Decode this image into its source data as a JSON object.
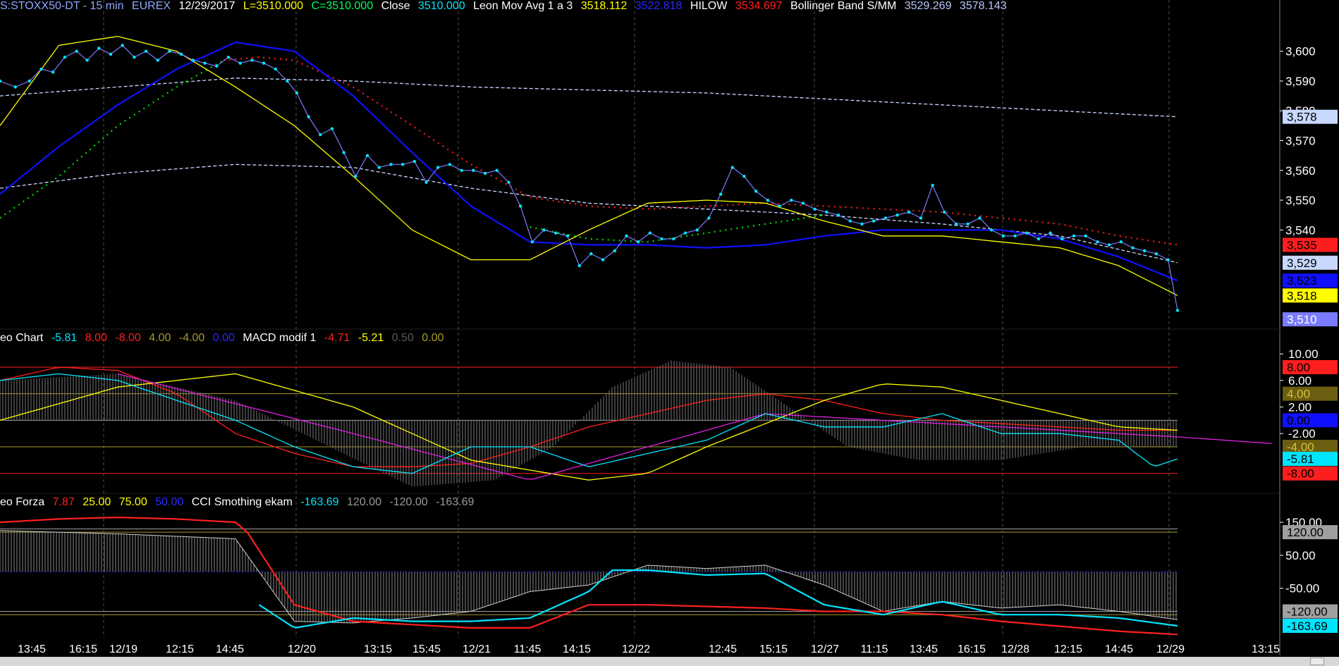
{
  "header": {
    "symbol": "S:STOXX50-DT - 15 min",
    "exchange": "EUREX",
    "date": "12/29/2017",
    "low": "L=3510.000",
    "close_eq": "C=3510.000",
    "close_label": "Close",
    "close_value": "3510.000",
    "leon_label": "Leon Mov Avg 1 a 3",
    "leon_v1": "3518.112",
    "leon_v2": "3522.818",
    "hilow_label": "HILOW",
    "hilow_value": "3534.697",
    "boll_label": "Bollinger Band S/MM",
    "boll_v1": "3529.269",
    "boll_v2": "3578.143"
  },
  "panel1_header": {
    "name": "eo Chart",
    "v1": "-5.81",
    "v2": "8.00",
    "v3": "-8.00",
    "v4": "4.00",
    "v5": "-4.00",
    "v6": "0.00",
    "macd_label": "MACD modif 1",
    "m1": "-4.71",
    "m2": "-5.21",
    "m3": "0.50",
    "m4": "0.00"
  },
  "panel2_header": {
    "name": "eo Forza",
    "v1": "7.87",
    "v2": "25.00",
    "v3": "75.00",
    "v4": "50.00",
    "cci_label": "CCI Smothing ekam",
    "c1": "-163.69",
    "c2": "120.00",
    "c3": "-120.00",
    "c4": "-163.69"
  },
  "colors": {
    "price": "#00e5ff",
    "price_line": "#7b7bff",
    "leon_fast": "#ffff00",
    "leon_slow": "#1010ff",
    "hilow": "#ff1e1e",
    "boll": "#c8d8ff",
    "green": "#00e000",
    "magenta": "#e020e0",
    "grid": "#404040"
  },
  "chart_data": [
    {
      "type": "line",
      "title": "S:STOXX50-DT - 15 min",
      "xlabel": "",
      "ylabel": "",
      "ylim": [
        3506,
        3612
      ],
      "yticks": [
        "3,600",
        "3,590",
        "3,580",
        "3,570",
        "3,560",
        "3,550",
        "3,540"
      ],
      "ytick_values": [
        3600,
        3590,
        3580,
        3570,
        3560,
        3550,
        3540
      ],
      "x_labels": [
        "13:45",
        "16:15",
        "12/19",
        "12:15",
        "14:45",
        "12/20",
        "13:15",
        "15:45",
        "12/21",
        "11:45",
        "14:15",
        "12/22",
        "12:45",
        "15:15",
        "12/27",
        "11:15",
        "13:45",
        "16:15",
        "12/28",
        "12:15",
        "14:45",
        "12/29",
        "13:15"
      ],
      "series": [
        {
          "name": "Close",
          "color": "#00e5ff",
          "t": [
            0,
            0.013,
            0.025,
            0.035,
            0.045,
            0.055,
            0.065,
            0.074,
            0.084,
            0.094,
            0.104,
            0.114,
            0.124,
            0.134,
            0.144,
            0.154,
            0.164,
            0.174,
            0.184,
            0.194,
            0.204,
            0.214,
            0.224,
            0.234,
            0.244,
            0.252,
            0.262,
            0.272,
            0.282,
            0.292,
            0.302,
            0.312,
            0.322,
            0.332,
            0.342,
            0.352,
            0.362,
            0.372,
            0.382,
            0.392,
            0.402,
            0.412,
            0.422,
            0.432,
            0.442,
            0.452,
            0.462,
            0.472,
            0.482,
            0.492,
            0.502,
            0.512,
            0.522,
            0.532,
            0.542,
            0.552,
            0.562,
            0.572,
            0.582,
            0.592,
            0.602,
            0.612,
            0.622,
            0.632,
            0.642,
            0.652,
            0.662,
            0.672,
            0.682,
            0.692,
            0.702,
            0.712,
            0.722,
            0.732,
            0.742,
            0.752,
            0.762,
            0.772,
            0.782,
            0.792,
            0.802,
            0.812,
            0.822,
            0.832,
            0.842,
            0.852,
            0.862,
            0.872,
            0.882,
            0.892,
            0.902,
            0.912,
            0.922,
            0.932,
            0.942,
            0.952,
            0.962,
            0.972,
            0.982,
            0.992,
            1.0
          ],
          "values": [
            3590,
            3588,
            3590,
            3594,
            3593,
            3598,
            3600,
            3597,
            3601,
            3599,
            3602,
            3598,
            3600,
            3597,
            3600,
            3599,
            3597,
            3596,
            3595,
            3598,
            3596,
            3597,
            3596,
            3594,
            3590,
            3586,
            3578,
            3572,
            3574,
            3566,
            3558,
            3565,
            3561,
            3562,
            3562,
            3563,
            3556,
            3561,
            3562,
            3560,
            3560,
            3559,
            3560,
            3556,
            3548,
            3536,
            3540,
            3539,
            3538,
            3528,
            3532,
            3530,
            3533,
            3538,
            3536,
            3539,
            3537,
            3537,
            3539,
            3540,
            3544,
            3552,
            3561,
            3558,
            3553,
            3550,
            3548,
            3550,
            3549,
            3547,
            3546,
            3545,
            3543,
            3542,
            3543,
            3544,
            3545,
            3546,
            3544,
            3555,
            3546,
            3542,
            3542,
            3544,
            3540,
            3538,
            3538,
            3539,
            3537,
            3539,
            3537,
            3538,
            3538,
            3536,
            3535,
            3536,
            3534,
            3533,
            3532,
            3530,
            3513,
            3510
          ]
        },
        {
          "name": "Leon Mov Avg 1 a 3",
          "color": "#ffff00",
          "t": [
            0,
            0.05,
            0.1,
            0.15,
            0.2,
            0.25,
            0.3,
            0.35,
            0.4,
            0.45,
            0.5,
            0.55,
            0.6,
            0.65,
            0.7,
            0.75,
            0.8,
            0.85,
            0.9,
            0.95,
            1.0
          ],
          "values": [
            3575,
            3602,
            3605,
            3600,
            3588,
            3575,
            3558,
            3540,
            3530,
            3530,
            3540,
            3549,
            3550,
            3549,
            3543,
            3538,
            3538,
            3536,
            3534,
            3528,
            3518
          ]
        },
        {
          "name": "3522.818",
          "color": "#1010ff",
          "t": [
            0,
            0.05,
            0.1,
            0.15,
            0.2,
            0.25,
            0.3,
            0.35,
            0.4,
            0.45,
            0.5,
            0.55,
            0.6,
            0.65,
            0.7,
            0.75,
            0.8,
            0.85,
            0.9,
            0.95,
            1.0
          ],
          "values": [
            3552,
            3568,
            3582,
            3594,
            3603,
            3600,
            3585,
            3566,
            3548,
            3536,
            3535,
            3535,
            3534,
            3535,
            3538,
            3540,
            3540,
            3540,
            3537,
            3531,
            3523
          ]
        },
        {
          "name": "HILOW",
          "color": "#ff1e1e",
          "t": [
            0.19,
            0.22,
            0.25,
            0.3,
            0.35,
            0.4,
            0.45,
            0.5,
            0.55,
            0.6,
            0.65,
            0.7,
            0.75,
            0.8,
            0.85,
            0.9,
            0.95,
            1.0
          ],
          "values": [
            3597,
            3598,
            3597,
            3588,
            3575,
            3562,
            3551,
            3548,
            3547,
            3548,
            3549,
            3548,
            3547,
            3546,
            3544,
            3542,
            3538,
            3535
          ]
        },
        {
          "name": "Bollinger Band S/MM",
          "color": "#c8d8ff",
          "t": [
            0,
            0.1,
            0.2,
            0.3,
            0.4,
            0.5,
            0.6,
            0.7,
            0.8,
            0.9,
            1.0
          ],
          "values": [
            3585,
            3588,
            3591,
            3590,
            3588,
            3587,
            3586,
            3584,
            3582,
            3580,
            3578
          ]
        }
      ]
    },
    {
      "type": "line",
      "title": "MACD modif 1",
      "ylim": [
        -11,
        11.5
      ],
      "yticks": [
        "10.00",
        "6.00",
        "2.00",
        "-2.00"
      ],
      "ytick_values": [
        10,
        6,
        2,
        -2
      ],
      "levels": [
        8,
        -8,
        4,
        -4,
        0
      ],
      "badges": [
        "8.00",
        "4.00",
        "0.00",
        "-4.00",
        "-5.81",
        "-8.00"
      ],
      "badge_values": [
        8,
        4,
        0,
        -4,
        -5.81,
        -8
      ],
      "series": [
        {
          "name": "-5.81",
          "color": "#00e5ff",
          "t": [
            0,
            0.05,
            0.1,
            0.15,
            0.2,
            0.25,
            0.3,
            0.35,
            0.4,
            0.45,
            0.5,
            0.55,
            0.6,
            0.65,
            0.7,
            0.75,
            0.8,
            0.85,
            0.9,
            0.95,
            0.98,
            1.0
          ],
          "values": [
            6,
            7,
            6,
            3,
            0,
            -4,
            -7,
            -8,
            -4,
            -4,
            -7,
            -5,
            -3,
            1,
            -1,
            -1,
            1,
            -2,
            -2,
            -3,
            -7,
            -5.81
          ]
        },
        {
          "name": "-4.71",
          "color": "#ff2020",
          "t": [
            0,
            0.05,
            0.1,
            0.15,
            0.2,
            0.25,
            0.3,
            0.35,
            0.4,
            0.45,
            0.5,
            0.55,
            0.6,
            0.65,
            0.7,
            0.75,
            0.8,
            0.85,
            0.9,
            0.95,
            1.0
          ],
          "values": [
            6,
            8,
            7.5,
            4,
            -2,
            -5,
            -7,
            -7,
            -6.5,
            -4,
            -1,
            1,
            3,
            4,
            3,
            1,
            0,
            -0.5,
            -1,
            -1.5,
            -1.5
          ]
        },
        {
          "name": "-5.21",
          "color": "#ffff00",
          "t": [
            0,
            0.1,
            0.2,
            0.3,
            0.4,
            0.5,
            0.55,
            0.6,
            0.7,
            0.75,
            0.8,
            0.85,
            0.9,
            0.95,
            1.0
          ],
          "values": [
            0,
            5,
            7,
            2,
            -6,
            -9,
            -8,
            -4,
            3,
            5.5,
            5,
            3,
            1,
            -1,
            -1.5
          ]
        },
        {
          "name": "0.50",
          "color": "#e020e0",
          "t": [
            0.1,
            0.3,
            0.45,
            0.65,
            0.8,
            1.0,
            1.08
          ],
          "values": [
            7,
            -2,
            -9,
            1,
            -0.5,
            -2.5,
            -3.5
          ]
        }
      ]
    },
    {
      "type": "line",
      "title": "CCI Smothing ekam",
      "ylim": [
        -200,
        195
      ],
      "yticks": [
        "150.00",
        "50.00",
        "-50.00"
      ],
      "ytick_values": [
        150,
        50,
        -50
      ],
      "levels": [
        120,
        -120
      ],
      "badges": [
        "120.00",
        "-120.00",
        "-163.69"
      ],
      "badge_values": [
        120,
        -120,
        -163.69
      ],
      "series": [
        {
          "name": "-163.69",
          "color": "#00e5ff",
          "t": [
            0.22,
            0.25,
            0.3,
            0.35,
            0.4,
            0.45,
            0.5,
            0.52,
            0.55,
            0.6,
            0.65,
            0.7,
            0.75,
            0.8,
            0.85,
            0.9,
            0.95,
            1.0
          ],
          "values": [
            -100,
            -170,
            -140,
            -150,
            -150,
            -140,
            -60,
            5,
            5,
            -10,
            -5,
            -100,
            -130,
            -90,
            -130,
            -130,
            -140,
            -163.69
          ]
        },
        {
          "name": "7.87",
          "color": "#ff2020",
          "t": [
            0,
            0.05,
            0.1,
            0.15,
            0.2,
            0.21,
            0.25,
            0.3,
            0.35,
            0.4,
            0.45,
            0.5,
            0.55,
            0.6,
            0.65,
            0.7,
            0.75,
            0.8,
            0.85,
            0.9,
            0.95,
            1.0
          ],
          "values": [
            150,
            160,
            165,
            160,
            150,
            120,
            -100,
            -150,
            -160,
            -170,
            -170,
            -100,
            -100,
            -105,
            -110,
            -120,
            -120,
            -130,
            -150,
            -165,
            -180,
            -190
          ]
        },
        {
          "name": "120.00",
          "color": "#bbbbbb",
          "t": [
            0,
            0.1,
            0.2,
            0.25,
            0.3,
            0.35,
            0.4,
            0.45,
            0.5,
            0.55,
            0.6,
            0.65,
            0.7,
            0.75,
            0.8,
            0.85,
            0.9,
            0.95,
            1.0
          ],
          "values": [
            125,
            115,
            100,
            -150,
            -155,
            -140,
            -120,
            -60,
            -40,
            20,
            10,
            20,
            -40,
            -120,
            -90,
            -110,
            -100,
            -120,
            -145
          ]
        }
      ]
    }
  ]
}
